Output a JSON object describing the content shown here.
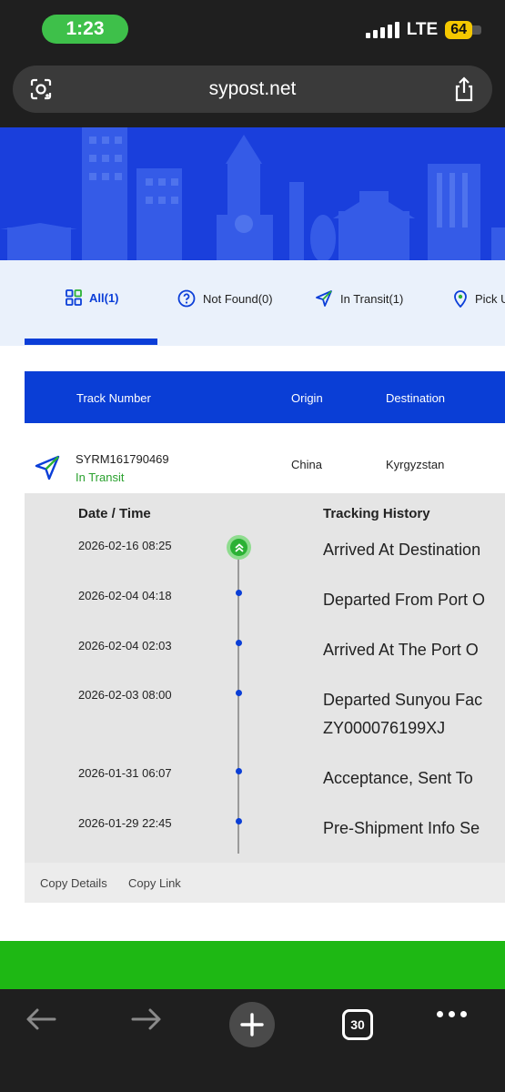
{
  "status": {
    "time": "1:23",
    "network": "LTE",
    "battery": "64"
  },
  "browser": {
    "url": "sypost.net",
    "tab_count": "30"
  },
  "tabs": [
    {
      "label": "All(1)",
      "icon": "grid-icon"
    },
    {
      "label": "Not Found(0)",
      "icon": "question-circle-icon"
    },
    {
      "label": "In Transit(1)",
      "icon": "navigation-arrow-icon"
    },
    {
      "label": "Pick U",
      "icon": "location-pin-icon"
    }
  ],
  "table": {
    "headers": {
      "track_number": "Track Number",
      "origin": "Origin",
      "destination": "Destination"
    },
    "row": {
      "track_number": "SYRM161790469",
      "status": "In Transit",
      "origin": "China",
      "destination": "Kyrgyzstan"
    }
  },
  "history": {
    "date_header": "Date / Time",
    "history_header": "Tracking History",
    "events": [
      {
        "datetime": "2026-02-16 08:25",
        "description": "Arrived At Destination"
      },
      {
        "datetime": "2026-02-04 04:18",
        "description": "Departed From Port O"
      },
      {
        "datetime": "2026-02-04 02:03",
        "description": "Arrived At The Port O"
      },
      {
        "datetime": "2026-02-03 08:00",
        "description": "Departed Sunyou Fac",
        "description_line2": "ZY000076199XJ"
      },
      {
        "datetime": "2026-01-31 06:07",
        "description": "Acceptance, Sent To"
      },
      {
        "datetime": "2026-01-29 22:45",
        "description": "Pre-Shipment Info Se"
      }
    ]
  },
  "actions": {
    "copy_details": "Copy Details",
    "copy_link": "Copy Link"
  },
  "colors": {
    "brand_blue": "#0a3ed6",
    "transit_green": "#2aa12e",
    "hero_blue": "#1a3fdc"
  }
}
